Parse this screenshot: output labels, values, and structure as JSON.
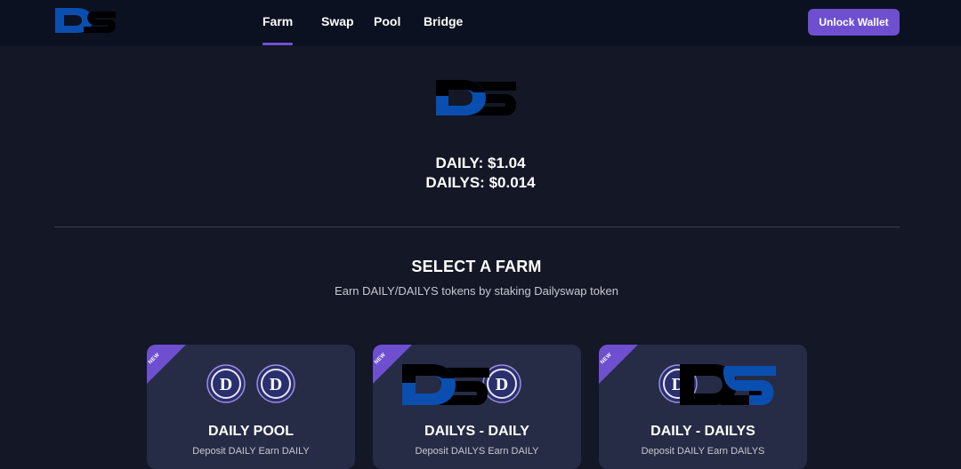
{
  "nav": {
    "items": [
      {
        "label": "Farm",
        "active": true
      },
      {
        "label": "Swap",
        "active": false
      },
      {
        "label": "Pool",
        "active": false
      },
      {
        "label": "Bridge",
        "active": false
      }
    ],
    "unlock_label": "Unlock Wallet"
  },
  "prices": {
    "daily": "DAILY: $1.04",
    "dailys": "DAILYS: $0.014"
  },
  "section": {
    "title": "SELECT A FARM",
    "subtitle": "Earn DAILY/DAILYS tokens by staking Dailyswap token"
  },
  "cards": [
    {
      "badge": "NEW",
      "title": "DAILY POOL",
      "desc": "Deposit DAILY Earn DAILY"
    },
    {
      "badge": "NEW",
      "title": "DAILYS - DAILY",
      "desc": "Deposit DAILYS Earn DAILY"
    },
    {
      "badge": "NEW",
      "title": "DAILY - DAILYS",
      "desc": "Deposit DAILY Earn DAILYS"
    }
  ],
  "icons": {
    "coin_letter": "D"
  },
  "colors": {
    "accent": "#6e4fcf",
    "logo_blue": "#0a4fb0",
    "logo_black": "#000000",
    "background": "#131726",
    "topbar": "#0b1120",
    "card": "#262c45"
  }
}
